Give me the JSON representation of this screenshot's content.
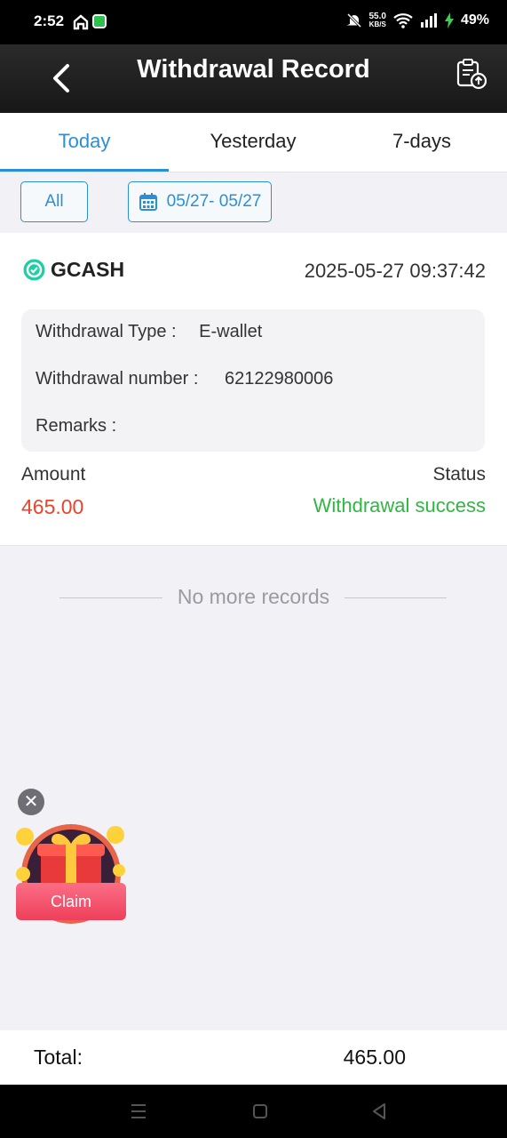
{
  "status_bar": {
    "time": "2:52",
    "net_speed_value": "55.0",
    "net_speed_unit": "KB/S",
    "battery": "49%",
    "icons": [
      "home-icon",
      "shield-icon",
      "mute-bell-icon",
      "wifi-icon",
      "signal-icon",
      "charging-icon"
    ]
  },
  "app_bar": {
    "title": "Withdrawal Record",
    "back_icon": "chevron-left-icon",
    "action_icon": "export-record-icon"
  },
  "tabs": [
    {
      "label": "Today",
      "active": true
    },
    {
      "label": "Yesterday",
      "active": false
    },
    {
      "label": "7-days",
      "active": false
    }
  ],
  "filter": {
    "all_label": "All",
    "date_range": "05/27- 05/27"
  },
  "record": {
    "provider": "GCASH",
    "datetime": "2025-05-27 09:37:42",
    "type_label": "Withdrawal Type :",
    "type_value": "E-wallet",
    "number_label": "Withdrawal number :",
    "number_value": "62122980006",
    "remarks_label": "Remarks :",
    "remarks_value": "",
    "amount_label": "Amount",
    "amount_value": "465.00",
    "status_label": "Status",
    "status_value": "Withdrawal success"
  },
  "list_end": "No more records",
  "promo": {
    "claim_label": "Claim",
    "close_icon": "close-icon"
  },
  "footer": {
    "total_label": "Total:",
    "total_value": "465.00"
  },
  "colors": {
    "accent": "#2b8fd6",
    "amount": "#e8442e",
    "success": "#2fb742",
    "gcash": "#1ecfa4"
  }
}
